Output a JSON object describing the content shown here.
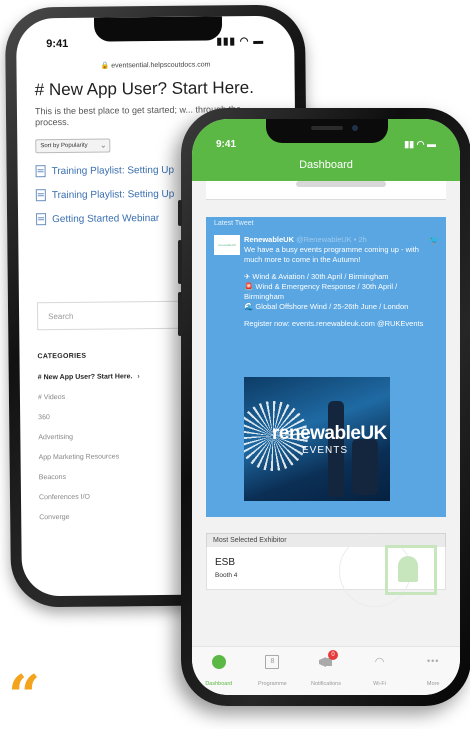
{
  "back_phone": {
    "status_time": "9:41",
    "url": "eventsential.helpscoutdocs.com",
    "page_title": "# New App User? Start Here.",
    "page_subtitle": "This is the best place to get started; w... through the process.",
    "sort_label": "Sort by Popularity",
    "articles": [
      {
        "title": "Training Playlist: Setting Up"
      },
      {
        "title": "Training Playlist: Setting Up"
      },
      {
        "title": "Getting Started Webinar"
      }
    ],
    "search_placeholder": "Search",
    "categories_heading": "CATEGORIES",
    "categories": [
      "# New App User? Start Here.",
      "# Videos",
      "360",
      "Advertising",
      "App Marketing Resources",
      "Beacons",
      "Conferences I/O",
      "Converge"
    ]
  },
  "front_phone": {
    "status_time": "9:41",
    "header_title": "Dashboard",
    "accent_color": "#5cb845",
    "tweet": {
      "section_label": "Latest Tweet",
      "logo_text": "renewableUK",
      "author": "RenewableUK",
      "handle": "@RenewableUK • 2h",
      "line1": "We have a busy events programme coming up - with much more to come in the Autumn!",
      "line2": "✈ Wind & Aviation / 30th April / Birmingham",
      "line3": "🚨 Wind & Emergency Response / 30th April / Birmingham",
      "line4": "🌊 Global Offshore Wind / 25-26th June / London",
      "line5": "Register now: events.renewableuk.com @RUKEvents",
      "image_logo": "renewableUK",
      "image_sub": "EVENTS"
    },
    "exhibitor": {
      "heading": "Most Selected Exhibitor",
      "name": "ESB",
      "booth": "Booth 4"
    },
    "tabs": [
      {
        "label": "Dashboard",
        "icon": "dashboard-icon"
      },
      {
        "label": "Programme",
        "icon": "calendar-icon",
        "icon_text": "8"
      },
      {
        "label": "Notifications",
        "icon": "megaphone-icon",
        "badge": "0"
      },
      {
        "label": "Wi-Fi",
        "icon": "wifi-icon"
      },
      {
        "label": "More",
        "icon": "more-icon"
      }
    ]
  },
  "quote_mark": "“",
  "quote_color": "#f3a41c"
}
